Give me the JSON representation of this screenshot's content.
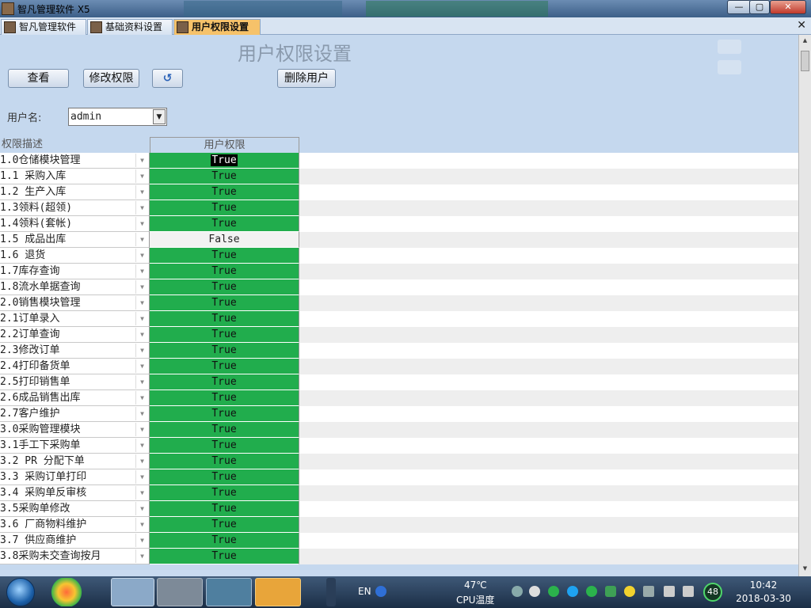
{
  "window": {
    "title": "智凡管理软件 X5",
    "min": "—",
    "max": "▢",
    "close": "✕"
  },
  "tabs": [
    {
      "label": "智凡管理软件"
    },
    {
      "label": "基础资料设置"
    },
    {
      "label": "用户权限设置"
    }
  ],
  "tab_close": "✕",
  "page_title": "用户权限设置",
  "toolbar": {
    "view": "查看",
    "modify": "修改权限",
    "undo": "↺",
    "delete": "删除用户"
  },
  "user": {
    "label": "用户名:",
    "value": "admin",
    "dropdown": "▼"
  },
  "grid": {
    "headers": [
      "权限描述",
      "用户权限"
    ],
    "rows": [
      {
        "desc": "1.0仓储模块管理",
        "perm": "True"
      },
      {
        "desc": "1.1 采购入库",
        "perm": "True"
      },
      {
        "desc": "1.2 生产入库",
        "perm": "True"
      },
      {
        "desc": "1.3领料(超领)",
        "perm": "True"
      },
      {
        "desc": "1.4领料(套帐)",
        "perm": "True"
      },
      {
        "desc": "1.5 成品出库",
        "perm": "False"
      },
      {
        "desc": "1.6 退货",
        "perm": "True"
      },
      {
        "desc": "1.7库存查询",
        "perm": "True"
      },
      {
        "desc": "1.8流水单据查询",
        "perm": "True"
      },
      {
        "desc": "2.0销售模块管理",
        "perm": "True"
      },
      {
        "desc": "2.1订单录入",
        "perm": "True"
      },
      {
        "desc": "2.2订单查询",
        "perm": "True"
      },
      {
        "desc": "2.3修改订单",
        "perm": "True"
      },
      {
        "desc": "2.4打印备货单",
        "perm": "True"
      },
      {
        "desc": "2.5打印销售单",
        "perm": "True"
      },
      {
        "desc": "2.6成品销售出库",
        "perm": "True"
      },
      {
        "desc": "2.7客户维护",
        "perm": "True"
      },
      {
        "desc": "3.0采购管理模块",
        "perm": "True"
      },
      {
        "desc": "3.1手工下采购单",
        "perm": "True"
      },
      {
        "desc": "3.2 PR 分配下单",
        "perm": "True"
      },
      {
        "desc": "3.3 采购订单打印",
        "perm": "True"
      },
      {
        "desc": "3.4 采购单反审核",
        "perm": "True"
      },
      {
        "desc": "3.5采购单修改",
        "perm": "True"
      },
      {
        "desc": "3.6 厂商物料维护",
        "perm": "True"
      },
      {
        "desc": "3.7 供应商维护",
        "perm": "True"
      },
      {
        "desc": "3.8采购未交查询按月",
        "perm": "True"
      }
    ]
  },
  "taskbar": {
    "lang": "EN",
    "temp": "47℃",
    "temp_label": "CPU温度",
    "badge": "48",
    "time": "10:42",
    "date": "2018-03-30"
  },
  "colors": {
    "true_cell": "#21ad4d",
    "false_cell": "#f2f2f2",
    "header_bg": "#c5d8ee"
  }
}
